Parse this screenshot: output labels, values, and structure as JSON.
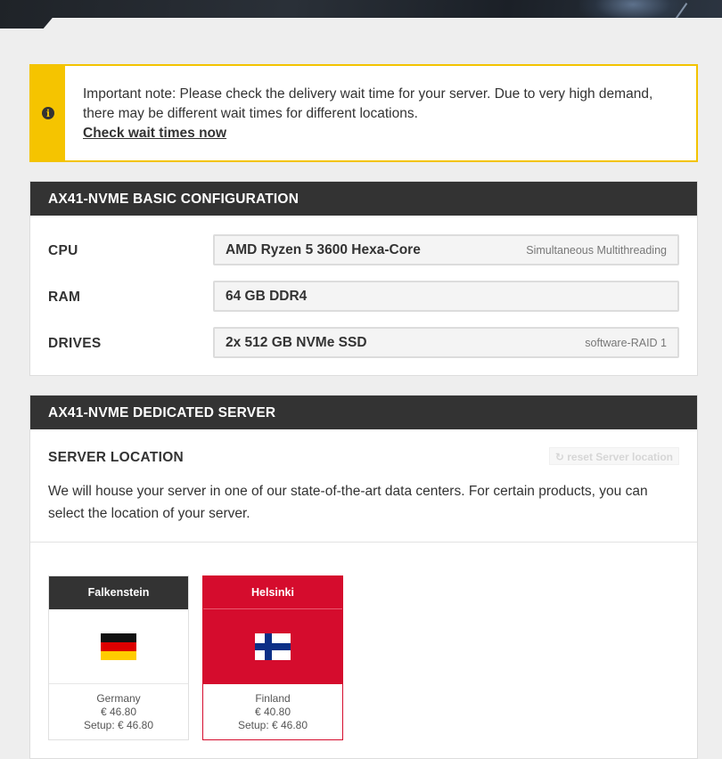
{
  "notice": {
    "text": "Important note: Please check the delivery wait time for your server. Due to very high demand, there may be different wait times for different locations.",
    "link": "Check wait times now",
    "accent_color": "#f5c400",
    "icon": "info-icon"
  },
  "basic_config": {
    "title": "AX41-NVME BASIC CONFIGURATION",
    "rows": [
      {
        "label": "CPU",
        "value": "AMD Ryzen 5 3600 Hexa-Core",
        "extra": "Simultaneous Multithreading"
      },
      {
        "label": "RAM",
        "value": "64 GB DDR4",
        "extra": ""
      },
      {
        "label": "DRIVES",
        "value": "2x 512 GB NVMe SSD",
        "extra": "software-RAID 1"
      }
    ]
  },
  "dedicated_server": {
    "title": "AX41-NVME DEDICATED SERVER",
    "location_title": "SERVER LOCATION",
    "reset_label": "reset Server location",
    "reset_icon": "refresh-icon",
    "description": "We will house your server in one of our state-of-the-art data centers. For certain products, you can select the location of your server.",
    "locations": [
      {
        "city": "Falkenstein",
        "country": "Germany",
        "price": "€ 46.80",
        "setup": "Setup: € 46.80",
        "flag": "germany-flag-icon",
        "selected": false
      },
      {
        "city": "Helsinki",
        "country": "Finland",
        "price": "€ 40.80",
        "setup": "Setup: € 46.80",
        "flag": "finland-flag-icon",
        "selected": true
      }
    ],
    "selected_color": "#d50c2d"
  }
}
